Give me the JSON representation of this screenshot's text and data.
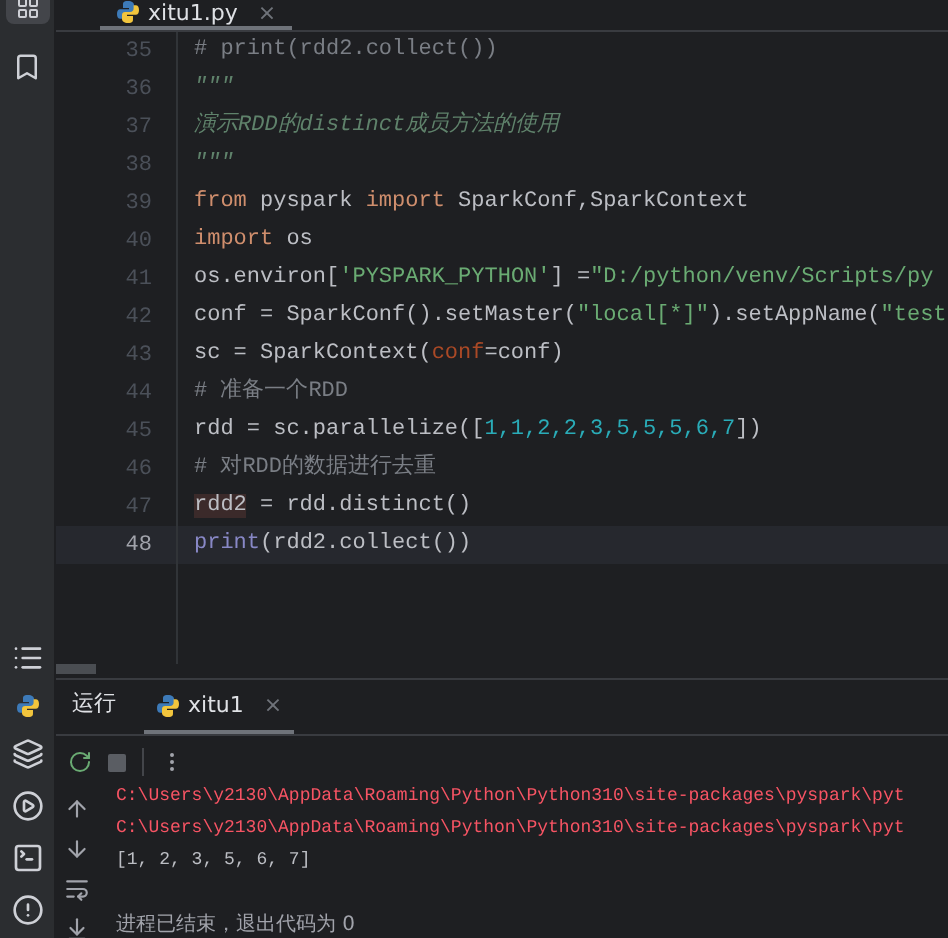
{
  "editor_tab": {
    "filename": "xitu1.py",
    "close": "×",
    "selected": true
  },
  "lines": [
    {
      "number": "35",
      "current": false,
      "tokens": [
        {
          "kind": "comment",
          "text": "# print(rdd2.collect())"
        }
      ]
    },
    {
      "number": "36",
      "current": false,
      "tokens": [
        {
          "kind": "docstring",
          "text": "\"\"\""
        }
      ]
    },
    {
      "number": "37",
      "current": false,
      "tokens": [
        {
          "kind": "docstring",
          "text": "演示RDD的distinct成员方法的使用"
        }
      ]
    },
    {
      "number": "38",
      "current": false,
      "tokens": [
        {
          "kind": "docstring",
          "text": "\"\"\""
        }
      ]
    },
    {
      "number": "39",
      "current": false,
      "tokens": [
        {
          "kind": "keyword",
          "text": "from"
        },
        {
          "kind": "plain",
          "text": " pyspark "
        },
        {
          "kind": "keyword",
          "text": "import"
        },
        {
          "kind": "plain",
          "text": " SparkConf,SparkContext"
        }
      ]
    },
    {
      "number": "40",
      "current": false,
      "tokens": [
        {
          "kind": "keyword",
          "text": "import"
        },
        {
          "kind": "plain",
          "text": " os"
        }
      ]
    },
    {
      "number": "41",
      "current": false,
      "tokens": [
        {
          "kind": "plain",
          "text": "os.environ["
        },
        {
          "kind": "string",
          "text": "'PYSPARK_PYTHON'"
        },
        {
          "kind": "plain",
          "text": "] ="
        },
        {
          "kind": "string",
          "text": "\"D:/python/venv/Scripts/py"
        }
      ]
    },
    {
      "number": "42",
      "current": false,
      "tokens": [
        {
          "kind": "plain",
          "text": "conf = SparkConf().setMaster("
        },
        {
          "kind": "string",
          "text": "\"local[*]\""
        },
        {
          "kind": "plain",
          "text": ").setAppName("
        },
        {
          "kind": "string",
          "text": "\"test"
        }
      ]
    },
    {
      "number": "43",
      "current": false,
      "tokens": [
        {
          "kind": "plain",
          "text": "sc = SparkContext("
        },
        {
          "kind": "param",
          "text": "conf"
        },
        {
          "kind": "plain",
          "text": "=conf)"
        }
      ]
    },
    {
      "number": "44",
      "current": false,
      "tokens": [
        {
          "kind": "comment",
          "text": "# 准备一个RDD"
        }
      ]
    },
    {
      "number": "45",
      "current": false,
      "tokens": [
        {
          "kind": "plain",
          "text": "rdd = sc.parallelize(["
        },
        {
          "kind": "number",
          "text": "1,1,2,2,3,5,5,5,6,7"
        },
        {
          "kind": "plain",
          "text": "])"
        }
      ]
    },
    {
      "number": "46",
      "current": false,
      "tokens": [
        {
          "kind": "comment",
          "text": "# 对RDD的数据进行去重"
        }
      ]
    },
    {
      "number": "47",
      "current": false,
      "tokens": [
        {
          "kind": "highlight",
          "text": "rdd2"
        },
        {
          "kind": "plain",
          "text": " = rdd.distinct()"
        }
      ]
    },
    {
      "number": "48",
      "current": true,
      "tokens": [
        {
          "kind": "builtin",
          "text": "print"
        },
        {
          "kind": "plain",
          "text": "(rdd2.collect())"
        }
      ]
    }
  ],
  "run_panel": {
    "title": "运行",
    "tabs": [
      {
        "label": "xitu1",
        "close": "×",
        "selected": true
      }
    ],
    "output": [
      {
        "kind": "error",
        "text": "C:\\Users\\y2130\\AppData\\Roaming\\Python\\Python310\\site-packages\\pyspark\\pyt"
      },
      {
        "kind": "error",
        "text": "C:\\Users\\y2130\\AppData\\Roaming\\Python\\Python310\\site-packages\\pyspark\\pyt"
      },
      {
        "kind": "normal",
        "text": "[1, 2, 3, 5, 6, 7]"
      }
    ],
    "status": "进程已结束，退出代码为 0"
  }
}
